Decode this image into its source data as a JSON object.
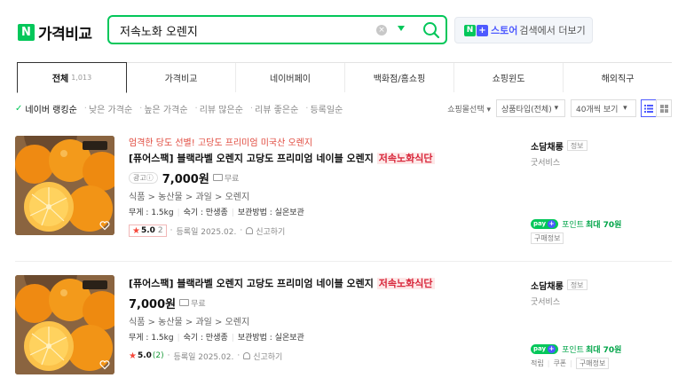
{
  "logo": {
    "mark": "N",
    "text": "가격비교"
  },
  "search": {
    "query": "저속노화 오렌지",
    "clear_glyph": "×"
  },
  "store_button": {
    "mark": "N",
    "plus": "+",
    "store": "스토어",
    "rest": "검색에서 더보기"
  },
  "tabs": [
    {
      "label": "전체",
      "count": "1,013",
      "active": true
    },
    {
      "label": "가격비교"
    },
    {
      "label": "네이버페이"
    },
    {
      "label": "백화점/홈쇼핑"
    },
    {
      "label": "쇼핑윈도"
    },
    {
      "label": "해외직구"
    }
  ],
  "sort": {
    "check_glyph": "✓",
    "items": [
      "네이버 랭킹순",
      "낮은 가격순",
      "높은 가격순",
      "리뷰 많은순",
      "리뷰 좋은순",
      "등록일순"
    ],
    "mall_select": "쇼핑몰선택",
    "product_type": "상품타입(전체)",
    "per_page": "40개씩 보기"
  },
  "products": [
    {
      "promo": "엄격한 당도 선별! 고당도 프리미엄 미국산 오렌지",
      "title_main": "[퓨어스팩] 블랙라벨 오렌지 고당도 프리미엄 네이블 오렌지",
      "title_highlight": "저속노화식단",
      "ad_label": "광고ⓘ",
      "price": "7,000원",
      "shipping": "무료",
      "category": "식품 > 농산물 > 과일 > 오렌지",
      "weight": "무게 : 1.5kg",
      "ripeness": "숙기 : 만생종",
      "storage": "보관방법 : 실온보관",
      "star": "★",
      "rating": "5.0",
      "review_count": "2",
      "registered": "등록일 2025.02.",
      "report": "신고하기",
      "seller": "소담채롱",
      "seller_tag": "정보",
      "seller_sub": "굿서비스",
      "pay_label": "pay",
      "pay_plus": "+",
      "pay_point": "포인트",
      "pay_max": "최대 70원",
      "buy_info": "구매정보"
    },
    {
      "promo": "",
      "title_main": "[퓨어스팩] 블랙라벨 오렌지 고당도 프리미엄 네이블 오렌지",
      "title_highlight": "저속노화식단",
      "ad_label": "",
      "price": "7,000원",
      "shipping": "무료",
      "category": "식품 > 농산물 > 과일 > 오렌지",
      "weight": "무게 : 1.5kg",
      "ripeness": "숙기 : 만생종",
      "storage": "보관방법 : 실온보관",
      "star": "★",
      "rating": "5.0",
      "review_count": "(2)",
      "registered": "등록일 2025.02.",
      "report": "신고하기",
      "seller": "소담채롱",
      "seller_tag": "정보",
      "seller_sub": "굿서비스",
      "pay_label": "pay",
      "pay_plus": "+",
      "pay_point": "포인트",
      "pay_max": "최대 70원",
      "tags": [
        "적립",
        "쿠폰",
        "구매정보"
      ]
    }
  ],
  "colors": {
    "accent": "#03c75a",
    "store": "#4e5aff",
    "highlight": "#d8263a",
    "promo": "#e0483c"
  }
}
